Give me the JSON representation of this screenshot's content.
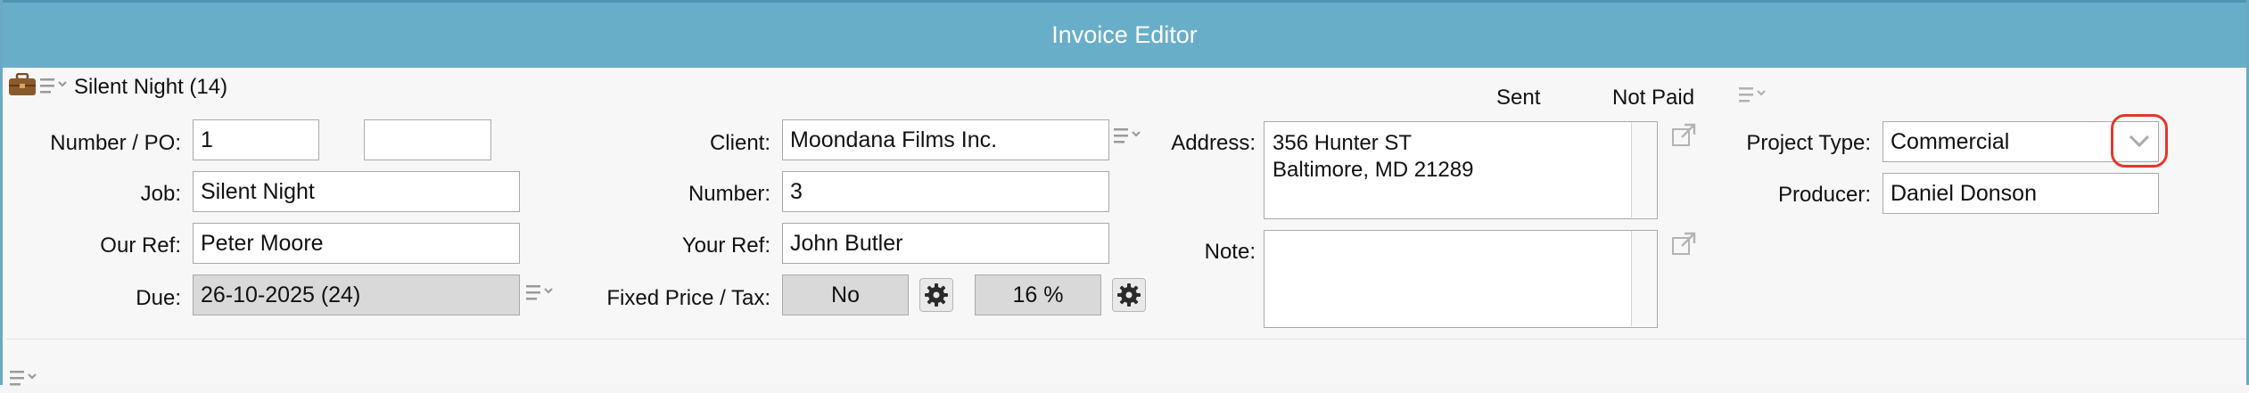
{
  "window": {
    "title": "Invoice Editor"
  },
  "record": {
    "title": "Silent Night (14)",
    "icon": "briefcase-icon"
  },
  "status": {
    "sent_label": "Sent",
    "paid_label": "Not Paid"
  },
  "fields": {
    "number_po": {
      "label": "Number / PO:",
      "value": "1",
      "po_value": ""
    },
    "job": {
      "label": "Job:",
      "value": "Silent Night"
    },
    "our_ref": {
      "label": "Our Ref:",
      "value": "Peter Moore"
    },
    "due": {
      "label": "Due:",
      "value": "26-10-2025 (24)"
    },
    "client": {
      "label": "Client:",
      "value": "Moondana Films Inc."
    },
    "number": {
      "label": "Number:",
      "value": "3"
    },
    "your_ref": {
      "label": "Your Ref:",
      "value": "John Butler"
    },
    "fixed_price_tax": {
      "label": "Fixed Price / Tax:",
      "fixed_price": "No",
      "tax": "16 %"
    },
    "address": {
      "label": "Address:",
      "line1": "356 Hunter ST",
      "line2": "Baltimore, MD 21289"
    },
    "note": {
      "label": "Note:",
      "value": ""
    },
    "project_type": {
      "label": "Project Type:",
      "value": "Commercial"
    },
    "producer": {
      "label": "Producer:",
      "value": "Daniel Donson"
    }
  },
  "colors": {
    "titlebar": "#69aec8",
    "highlight_ring": "#e0392b",
    "disabled_field": "#d9d9d9"
  }
}
